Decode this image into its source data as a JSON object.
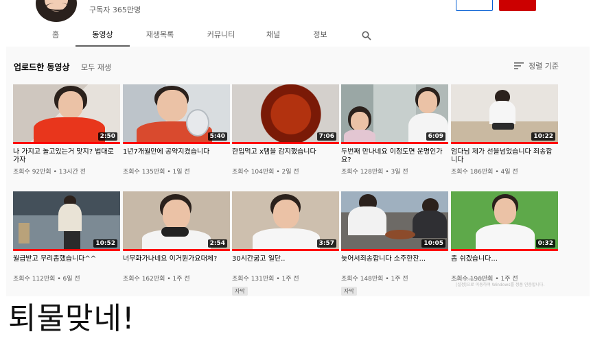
{
  "channel": {
    "subscribers": "구독자 365만명"
  },
  "tabs": [
    {
      "label": "홈"
    },
    {
      "label": "동영상",
      "active": true
    },
    {
      "label": "재생목록"
    },
    {
      "label": "커뮤니티"
    },
    {
      "label": "채널"
    },
    {
      "label": "정보"
    }
  ],
  "section": {
    "title": "업로드한 동영상",
    "play_all": "모두 재생",
    "sort_label": "정렬 기준"
  },
  "videos": [
    {
      "title": "나 가지고 놀고있는거 맞지? 법대로가자",
      "views": "조회수 92만회",
      "age": "13시간 전",
      "duration": "2:50",
      "badge": ""
    },
    {
      "title": "1년7개월만에 공약지켰습니다",
      "views": "조회수 135만회",
      "age": "1일 전",
      "duration": "5:40",
      "badge": ""
    },
    {
      "title": "한입먹고 x탬을 감지했습니다",
      "views": "조회수 104만회",
      "age": "2일 전",
      "duration": "7:06",
      "badge": ""
    },
    {
      "title": "두번째 만나네요 이정도면 운명인가요?",
      "views": "조회수 128만회",
      "age": "3일 전",
      "duration": "6:09",
      "badge": ""
    },
    {
      "title": "엄다님 제가 선을넘었습니다 죄송합니다",
      "views": "조회수 186만회",
      "age": "4일 전",
      "duration": "10:22",
      "badge": ""
    },
    {
      "title": "월급받고 무리좀했습니다^^",
      "views": "조회수 112만회",
      "age": "6일 전",
      "duration": "10:52",
      "badge": ""
    },
    {
      "title": "너무화가나네요 이거뭔가요대체?",
      "views": "조회수 162만회",
      "age": "1주 전",
      "duration": "2:54",
      "badge": ""
    },
    {
      "title": "30시간굶고 일단..",
      "views": "조회수 131만회",
      "age": "1주 전",
      "duration": "3:57",
      "badge": "자막"
    },
    {
      "title": "늦어서죄송합니다 소주한잔...",
      "views": "조회수 148만회",
      "age": "1주 전",
      "duration": "10:05",
      "badge": "자막"
    },
    {
      "title": "좀 쉬겠습니다...",
      "views": "조회수 196만회",
      "age": "1주 전",
      "duration": "0:32",
      "badge": ""
    }
  ],
  "separator": "•",
  "watermark": {
    "line1": "Windows 정품 인증",
    "line2": "[설정]으로 이동하여 Windows를 정품 인증합니다."
  },
  "caption": "퇴물맞네!",
  "colors": {
    "accent_red": "#ff0000",
    "subscribe_red": "#cc0000",
    "panel_bg": "#f9f9f9",
    "meta_gray": "#606060"
  }
}
